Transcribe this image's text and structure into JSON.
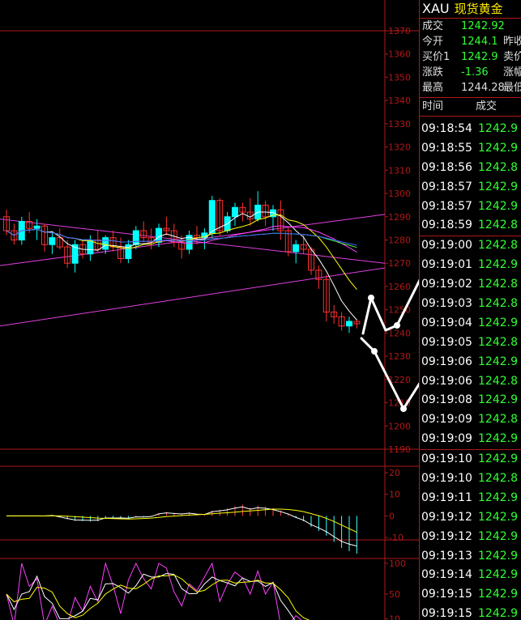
{
  "chart_data": {
    "type": "candlestick",
    "price_axis": {
      "ticks": [
        "1370",
        "1360",
        "1350",
        "1340",
        "1330",
        "1320",
        "1310",
        "1300",
        "1290",
        "1280",
        "1270",
        "1260",
        "1250",
        "1240",
        "1230",
        "1220",
        "1210",
        "1200",
        "1190"
      ],
      "range": [
        1190,
        1370
      ]
    },
    "macd_axis": {
      "ticks": [
        "20",
        "10",
        "0",
        "-10"
      ],
      "range": [
        -10,
        20
      ]
    },
    "kdj_axis": {
      "ticks": [
        "100",
        "50",
        "10"
      ],
      "range": [
        0,
        100
      ]
    },
    "candles": [
      [
        1290,
        1293,
        1282,
        1284
      ],
      [
        1284,
        1287,
        1278,
        1280
      ],
      [
        1280,
        1290,
        1278,
        1288
      ],
      [
        1288,
        1292,
        1283,
        1285
      ],
      [
        1285,
        1289,
        1280,
        1286
      ],
      [
        1286,
        1287,
        1275,
        1278
      ],
      [
        1278,
        1283,
        1274,
        1281
      ],
      [
        1281,
        1285,
        1276,
        1277
      ],
      [
        1277,
        1280,
        1268,
        1270
      ],
      [
        1270,
        1280,
        1266,
        1278
      ],
      [
        1278,
        1280,
        1272,
        1274
      ],
      [
        1274,
        1282,
        1271,
        1280
      ],
      [
        1280,
        1284,
        1275,
        1276
      ],
      [
        1276,
        1282,
        1274,
        1281
      ],
      [
        1281,
        1284,
        1275,
        1277
      ],
      [
        1277,
        1281,
        1270,
        1272
      ],
      [
        1272,
        1280,
        1270,
        1278
      ],
      [
        1278,
        1286,
        1276,
        1284
      ],
      [
        1284,
        1288,
        1279,
        1281
      ],
      [
        1281,
        1285,
        1276,
        1279
      ],
      [
        1279,
        1287,
        1277,
        1285
      ],
      [
        1285,
        1290,
        1282,
        1284
      ],
      [
        1284,
        1287,
        1277,
        1279
      ],
      [
        1279,
        1282,
        1272,
        1276
      ],
      [
        1276,
        1284,
        1274,
        1282
      ],
      [
        1282,
        1286,
        1278,
        1281
      ],
      [
        1281,
        1285,
        1276,
        1283
      ],
      [
        1283,
        1299,
        1281,
        1297
      ],
      [
        1297,
        1298,
        1282,
        1284
      ],
      [
        1284,
        1292,
        1283,
        1290
      ],
      [
        1290,
        1296,
        1286,
        1294
      ],
      [
        1294,
        1296,
        1288,
        1292
      ],
      [
        1292,
        1298,
        1286,
        1289
      ],
      [
        1289,
        1301,
        1288,
        1295
      ],
      [
        1295,
        1297,
        1286,
        1290
      ],
      [
        1290,
        1295,
        1284,
        1293
      ],
      [
        1293,
        1297,
        1280,
        1284
      ],
      [
        1284,
        1286,
        1273,
        1275
      ],
      [
        1275,
        1280,
        1270,
        1278
      ],
      [
        1278,
        1282,
        1274,
        1276
      ],
      [
        1276,
        1277,
        1265,
        1267
      ],
      [
        1267,
        1269,
        1259,
        1263
      ],
      [
        1263,
        1265,
        1245,
        1249
      ],
      [
        1249,
        1252,
        1244,
        1247
      ],
      [
        1247,
        1249,
        1241,
        1243
      ],
      [
        1243,
        1247,
        1240,
        1245
      ],
      [
        1245,
        1246,
        1242,
        1244
      ]
    ],
    "trend_lines": [
      {
        "color": "#e040e0",
        "p1": [
          0,
          1289
        ],
        "p2": [
          1,
          1270
        ]
      },
      {
        "color": "#e040e0",
        "p1": [
          0,
          1269
        ],
        "p2": [
          1,
          1291
        ]
      },
      {
        "color": "#e040e0",
        "p1": [
          0,
          1243
        ],
        "p2": [
          1,
          1268
        ]
      }
    ]
  },
  "quote": {
    "symbol": "XAU",
    "name": "现货黄金",
    "rows": [
      {
        "label": "成交",
        "value": "1242.92",
        "extra": ""
      },
      {
        "label": "今开",
        "value": "1244.1",
        "extra": "昨收"
      },
      {
        "label": "买价1",
        "value": "1242.9",
        "extra": "卖价"
      },
      {
        "label": "涨跌",
        "value": "-1.36",
        "extra": "涨幅"
      },
      {
        "label": "最高",
        "value": "1244.28",
        "extra": "最低"
      }
    ]
  },
  "ticks": {
    "header_time": "时间",
    "header_price": "成交",
    "rows": [
      {
        "time": "09:18:54",
        "price": "1242.9"
      },
      {
        "time": "09:18:55",
        "price": "1242.9"
      },
      {
        "time": "09:18:56",
        "price": "1242.8"
      },
      {
        "time": "09:18:57",
        "price": "1242.9"
      },
      {
        "time": "09:18:57",
        "price": "1242.9"
      },
      {
        "time": "09:18:59",
        "price": "1242.8"
      },
      {
        "time": "09:19:00",
        "price": "1242.8"
      },
      {
        "time": "09:19:01",
        "price": "1242.9"
      },
      {
        "time": "09:19:02",
        "price": "1242.8"
      },
      {
        "time": "09:19:03",
        "price": "1242.8"
      },
      {
        "time": "09:19:04",
        "price": "1242.9"
      },
      {
        "time": "09:19:05",
        "price": "1242.8"
      },
      {
        "time": "09:19:06",
        "price": "1242.9"
      },
      {
        "time": "09:19:06",
        "price": "1242.8"
      },
      {
        "time": "09:19:08",
        "price": "1242.9"
      },
      {
        "time": "09:19:09",
        "price": "1242.8"
      },
      {
        "time": "09:19:09",
        "price": "1242.9"
      },
      {
        "time": "09:19:10",
        "price": "1242.9"
      },
      {
        "time": "09:19:10",
        "price": "1242.8"
      },
      {
        "time": "09:19:11",
        "price": "1242.9"
      },
      {
        "time": "09:19:12",
        "price": "1242.9"
      },
      {
        "time": "09:19:12",
        "price": "1242.9"
      },
      {
        "time": "09:19:13",
        "price": "1242.9"
      },
      {
        "time": "09:19:14",
        "price": "1242.9"
      },
      {
        "time": "09:19:15",
        "price": "1242.9"
      },
      {
        "time": "09:19:15",
        "price": "1242.9"
      }
    ]
  },
  "colors": {
    "up": "#00ffff",
    "down": "#ff3030",
    "grid": "#b01818",
    "axis_text": "#b01818",
    "tick_price": "#33ff33"
  }
}
